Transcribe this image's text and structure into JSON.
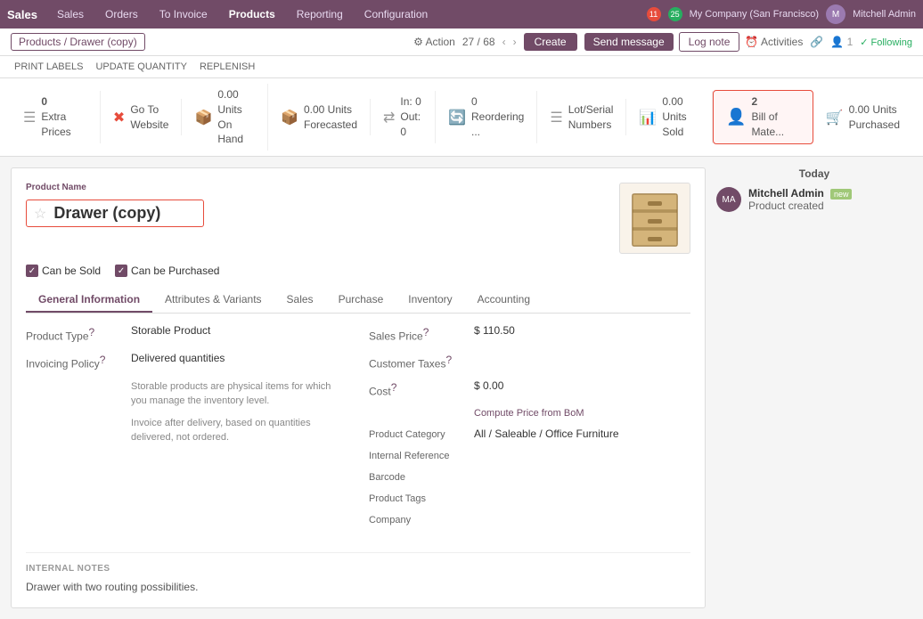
{
  "navbar": {
    "brand": "Sales",
    "items": [
      "Sales",
      "Orders",
      "To Invoice",
      "Products",
      "Reporting",
      "Configuration"
    ],
    "active_item": "Products",
    "notifications_count": "11",
    "updates_count": "25",
    "company": "My Company (San Francisco)",
    "user": "Mitchell Admin"
  },
  "breadcrumb": {
    "parent": "Products",
    "current": "Drawer (copy)",
    "full": "Products / Drawer (copy)"
  },
  "toolbar": {
    "action_label": "⚙ Action",
    "counter": "27 / 68",
    "create_label": "Create",
    "send_message_label": "Send message",
    "log_note_label": "Log note",
    "activities_label": "⏰ Activities",
    "following_label": "✓ Following"
  },
  "actions": {
    "print_labels": "PRINT LABELS",
    "update_quantity": "UPDATE QUANTITY",
    "replenish": "REPLENISH"
  },
  "stats": [
    {
      "id": "extra-prices",
      "icon": "☰",
      "icon_color": "normal",
      "line1": "0",
      "line2": "Extra Prices"
    },
    {
      "id": "go-to-website",
      "icon": "✖",
      "icon_color": "red",
      "line1": "Go To",
      "line2": "Website"
    },
    {
      "id": "on-hand",
      "icon": "📦",
      "icon_color": "normal",
      "line1": "0.00 Units",
      "line2": "On Hand"
    },
    {
      "id": "forecasted",
      "icon": "📦",
      "icon_color": "normal",
      "line1": "0.00 Units",
      "line2": "Forecasted"
    },
    {
      "id": "in-out",
      "icon": "↔",
      "icon_color": "normal",
      "line1": "In: 0",
      "line2": "Out: 0"
    },
    {
      "id": "reordering",
      "icon": "🔄",
      "icon_color": "normal",
      "line1": "0",
      "line2": "Reordering ..."
    },
    {
      "id": "lot-serial",
      "icon": "☰",
      "icon_color": "normal",
      "line1": "Lot/Serial",
      "line2": "Numbers"
    },
    {
      "id": "units-sold",
      "icon": "📊",
      "icon_color": "normal",
      "line1": "0.00 Units",
      "line2": "Sold"
    },
    {
      "id": "bill-of-materials",
      "icon": "👤",
      "icon_color": "highlighted",
      "line1": "2",
      "line2": "Bill of Mate...",
      "active": true
    },
    {
      "id": "units-purchased",
      "icon": "🛒",
      "icon_color": "normal",
      "line1": "0.00 Units",
      "line2": "Purchased"
    }
  ],
  "product": {
    "name_label": "Product Name",
    "name": "Drawer (copy)",
    "can_be_sold": true,
    "can_be_sold_label": "Can be Sold",
    "can_be_purchased": true,
    "can_be_purchased_label": "Can be Purchased"
  },
  "tabs": [
    {
      "id": "general",
      "label": "General Information",
      "active": true
    },
    {
      "id": "attributes",
      "label": "Attributes & Variants"
    },
    {
      "id": "sales",
      "label": "Sales"
    },
    {
      "id": "purchase",
      "label": "Purchase"
    },
    {
      "id": "inventory",
      "label": "Inventory"
    },
    {
      "id": "accounting",
      "label": "Accounting"
    }
  ],
  "form_left": {
    "product_type_label": "Product Type",
    "product_type_value": "Storable Product",
    "invoicing_policy_label": "Invoicing Policy",
    "invoicing_policy_value": "Delivered quantities",
    "invoicing_desc1": "Storable products are physical items for which you manage the inventory level.",
    "invoicing_desc2": "Invoice after delivery, based on quantities delivered, not ordered."
  },
  "form_right": {
    "sales_price_label": "Sales Price",
    "sales_price_value": "$ 110.50",
    "customer_taxes_label": "Customer Taxes",
    "customer_taxes_value": "",
    "cost_label": "Cost",
    "cost_value": "$ 0.00",
    "compute_price_label": "Compute Price from BoM",
    "product_category_label": "Product Category",
    "product_category_value": "All / Saleable / Office Furniture",
    "internal_reference_label": "Internal Reference",
    "internal_reference_value": "",
    "barcode_label": "Barcode",
    "barcode_value": "",
    "product_tags_label": "Product Tags",
    "product_tags_value": "",
    "company_label": "Company",
    "company_value": ""
  },
  "internal_notes": {
    "label": "INTERNAL NOTES",
    "value": "Drawer with two routing possibilities."
  },
  "chatter": {
    "today_label": "Today",
    "author": "Mitchell Admin",
    "status": "new",
    "message": "Product created"
  }
}
